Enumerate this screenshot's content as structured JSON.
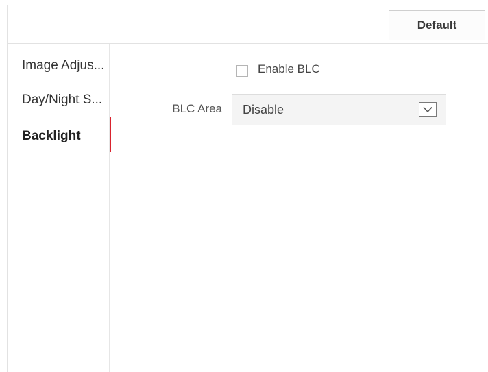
{
  "toolbar": {
    "default_label": "Default"
  },
  "sidebar": {
    "items": [
      {
        "label": "Image Adjus...",
        "active": false
      },
      {
        "label": "Day/Night S...",
        "active": false
      },
      {
        "label": "Backlight",
        "active": true
      }
    ]
  },
  "backlight": {
    "enable_blc": {
      "label": "Enable BLC",
      "checked": false
    },
    "blc_area": {
      "label": "BLC Area",
      "value": "Disable"
    }
  },
  "colors": {
    "active_marker": "#d9232e",
    "border": "#e2e2e2",
    "select_background": "#f4f4f4"
  },
  "icons": {
    "dropdown": "chevron-down-icon",
    "checkbox": "checkbox-unchecked"
  }
}
